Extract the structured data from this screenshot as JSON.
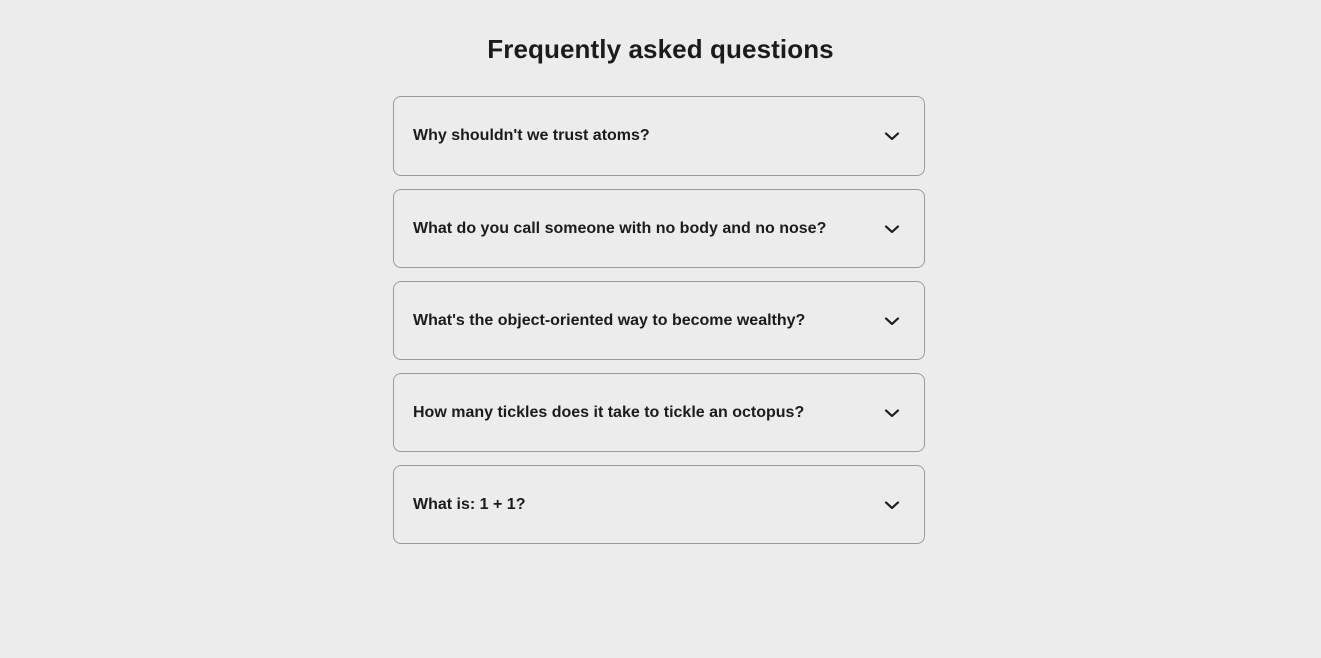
{
  "page": {
    "title": "Frequently asked questions"
  },
  "faq": {
    "items": [
      {
        "question": "Why shouldn't we trust atoms?",
        "icon": "chevron-down-icon"
      },
      {
        "question": "What do you call someone with no body and no nose?",
        "icon": "chevron-down-icon"
      },
      {
        "question": "What's the object-oriented way to become wealthy?",
        "icon": "chevron-down-icon"
      },
      {
        "question": "How many tickles does it take to tickle an octopus?",
        "icon": "chevron-down-icon"
      },
      {
        "question": "What is: 1 + 1?",
        "icon": "chevron-down-icon"
      }
    ]
  },
  "colors": {
    "background": "#ececec",
    "text": "#1b1b1b",
    "border": "#9a9a9a"
  }
}
